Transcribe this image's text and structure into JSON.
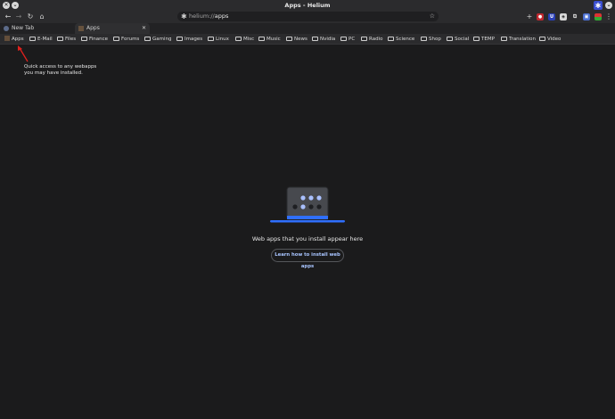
{
  "window": {
    "title": "Apps - Helium"
  },
  "toolbar": {
    "back_icon": "arrow-left-icon",
    "forward_icon": "arrow-right-icon",
    "reload_icon": "reload-icon",
    "home_icon": "home-icon",
    "url_scheme": "helium://",
    "url_path": "apps",
    "bookmark_icon": "star-icon",
    "colors": {
      "omnibox": "#1f1f21",
      "chrome": "#2b2b2d"
    }
  },
  "tabs": [
    {
      "label": "New Tab",
      "favicon": "helium-icon",
      "active": false
    },
    {
      "label": "Apps",
      "favicon": "apps-grid-icon",
      "active": true
    }
  ],
  "bookmarks": [
    {
      "label": "Apps",
      "icon": "apps-grid-icon"
    },
    {
      "label": "E-Mail",
      "icon": "folder-icon"
    },
    {
      "label": "Files",
      "icon": "folder-icon"
    },
    {
      "label": "Finance",
      "icon": "folder-icon"
    },
    {
      "label": "Forums",
      "icon": "folder-icon"
    },
    {
      "label": "Gaming",
      "icon": "folder-icon"
    },
    {
      "label": "Images",
      "icon": "folder-icon"
    },
    {
      "label": "Linux",
      "icon": "folder-icon"
    },
    {
      "label": "Misc",
      "icon": "folder-icon"
    },
    {
      "label": "Music",
      "icon": "folder-icon"
    },
    {
      "label": "News",
      "icon": "folder-icon"
    },
    {
      "label": "Nvidia",
      "icon": "folder-icon"
    },
    {
      "label": "PC",
      "icon": "folder-icon"
    },
    {
      "label": "Radio",
      "icon": "folder-icon"
    },
    {
      "label": "Science",
      "icon": "folder-icon"
    },
    {
      "label": "Shop",
      "icon": "folder-icon"
    },
    {
      "label": "Social",
      "icon": "folder-icon"
    },
    {
      "label": "TEMP",
      "icon": "folder-icon"
    },
    {
      "label": "Translation",
      "icon": "folder-icon"
    },
    {
      "label": "Video",
      "icon": "folder-icon"
    }
  ],
  "annotation": {
    "line1": "Quick access to any webapps",
    "line2": "you may have installed.",
    "arrow_color": "#e0211d"
  },
  "empty_state": {
    "message": "Web apps that you install appear here",
    "button_label": "Learn how to install web apps",
    "accent": "#2f6fff"
  }
}
